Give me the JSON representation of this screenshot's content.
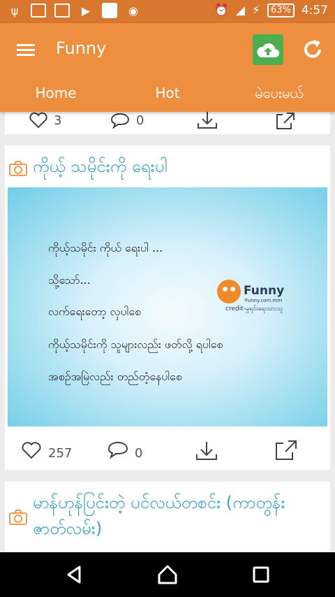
{
  "status_bar": {
    "battery": "63%",
    "time": "4:57"
  },
  "app_bar": {
    "title": "Funny",
    "tabs": [
      {
        "label": "Home"
      },
      {
        "label": "Hot"
      },
      {
        "label": "မဲပေးမယ်"
      }
    ]
  },
  "feed": {
    "prev_card": {
      "likes": "3",
      "comments": "0"
    },
    "post": {
      "title": "ကိုယ့် သမိုင်းကို ရေးပါ",
      "image_lines": [
        "ကိုယ့်သမိုင်း ကိုယ် ရေးပါ ...",
        "သို့သော်...",
        "လက်ရေးတော့ လှပါစေ",
        "ကိုယ့်သမိုင်းကို သူများလည်း ဖတ်လို့ ရပါစေ",
        "အစဉ်အမြဲလည်း တည်တံ့နေပါစေ"
      ],
      "logo": {
        "name": "Funny",
        "site": "Funny.com.mm",
        "credit": "credit-မှုရင်းရေးသားသူ"
      },
      "likes": "257",
      "comments": "0"
    },
    "next_post": {
      "title": "မာန်ဟုန်ပြင်းတဲ့ ပင်လယ်တစင်း (ကာတွန်းဇာတ်လမ်း)"
    }
  },
  "colors": {
    "status_bar": "#d9772f",
    "app_bar": "#ee8f3f",
    "upload_button": "#4cae4f",
    "title_blue": "#3c9fc7"
  }
}
